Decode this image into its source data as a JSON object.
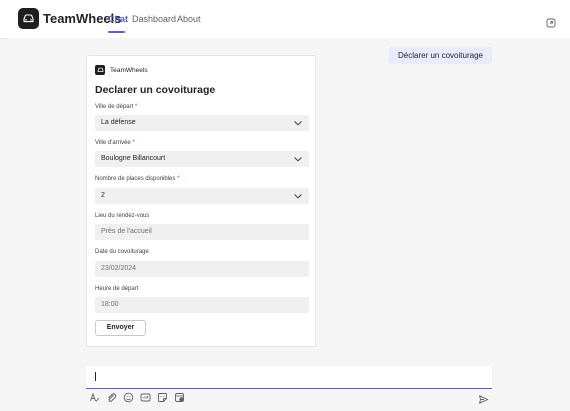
{
  "app": {
    "name": "TeamWheels",
    "icon": "car-icon"
  },
  "nav": {
    "tabs": [
      {
        "label": "Chat",
        "active": true
      },
      {
        "label": "Dashboard"
      },
      {
        "label": "About"
      }
    ]
  },
  "header": {
    "popout_icon": "popout-icon"
  },
  "user_message": {
    "text": "Déclarer un covoiturage"
  },
  "card": {
    "bot_name": "TeamWheels",
    "title": "Declarer un covoiturage",
    "fields": [
      {
        "label": "Ville de départ",
        "required": true,
        "value": "La défense",
        "type": "select"
      },
      {
        "label": "Ville d'arrivée",
        "required": true,
        "value": "Boulogne Billancourt",
        "type": "select"
      },
      {
        "label": "Nombre de places disponibles",
        "required": true,
        "value": "2",
        "type": "select"
      },
      {
        "label": "Lieu du rendez-vous",
        "required": false,
        "placeholder": "Près de l'accueil",
        "type": "text"
      },
      {
        "label": "Date du covoiturage",
        "required": false,
        "value": "23/02/2024",
        "type": "date"
      },
      {
        "label": "Heure de départ",
        "required": false,
        "value": "18:00",
        "type": "time"
      }
    ],
    "submit_label": "Envoyer"
  },
  "compose": {
    "tools": [
      "format-icon",
      "attach-icon",
      "emoji-icon",
      "gif-icon",
      "sticker-icon",
      "loop-icon"
    ],
    "send_icon": "send-icon"
  },
  "colors": {
    "accent": "#5b5fc7",
    "bubble": "#e8ebfa",
    "required": "#c4314b"
  }
}
